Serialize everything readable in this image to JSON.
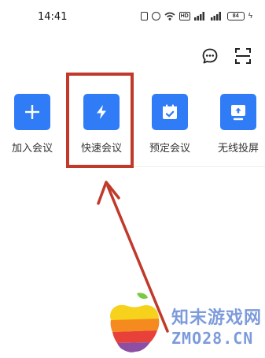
{
  "status_bar": {
    "time": "14:41",
    "battery": "84",
    "icons": [
      "nfc-icon",
      "alarm-icon",
      "wifi-icon",
      "hd-icon",
      "signal-icon",
      "signal-icon",
      "battery-icon",
      "charging-icon"
    ]
  },
  "top_actions": [
    {
      "icon": "chat-bubble-icon"
    },
    {
      "icon": "scan-icon"
    }
  ],
  "quick_actions": [
    {
      "label": "加入会议",
      "icon": "plus-icon"
    },
    {
      "label": "快速会议",
      "icon": "lightning-icon"
    },
    {
      "label": "预定会议",
      "icon": "calendar-check-icon"
    },
    {
      "label": "无线投屏",
      "icon": "screen-cast-icon"
    }
  ],
  "colors": {
    "accent": "#2f7cf6",
    "annotation": "#c0392b",
    "watermark": "#6f91d8"
  },
  "watermark": {
    "name": "知末游戏网",
    "domain": "ZMO28.CN"
  }
}
